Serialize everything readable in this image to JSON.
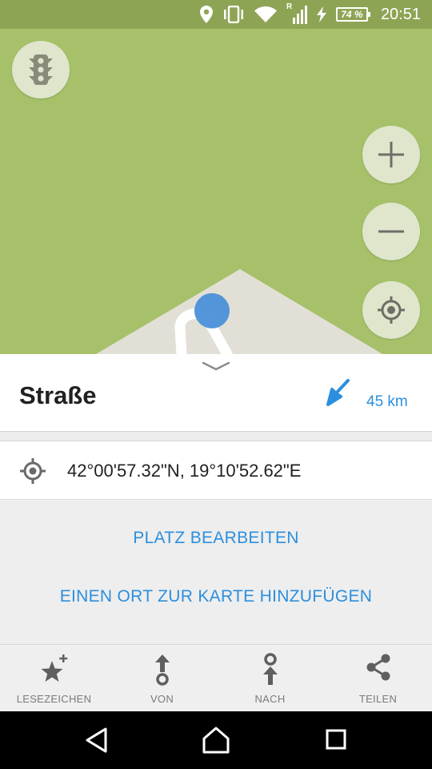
{
  "status_bar": {
    "battery_percent": "74 %",
    "clock": "20:51",
    "roaming_indicator": "R",
    "icons": [
      "location-icon",
      "vibrate-icon",
      "wifi-icon",
      "signal-icon",
      "charging-icon",
      "battery-icon"
    ]
  },
  "map": {
    "buttons": [
      "traffic-icon",
      "zoom-in-icon",
      "zoom-out-icon",
      "my-location-icon"
    ]
  },
  "place": {
    "title": "Straße",
    "distance": "45 km",
    "coordinates": "42°00'57.32\"N, 19°10'52.62\"E"
  },
  "actions": {
    "edit_place": "PLATZ BEARBEITEN",
    "add_place": "EINEN ORT ZUR KARTE HINZUFÜGEN"
  },
  "bottom_tabs": [
    {
      "label": "LESEZEICHEN",
      "icon": "bookmark-star-icon"
    },
    {
      "label": "VON",
      "icon": "route-from-icon"
    },
    {
      "label": "NACH",
      "icon": "route-to-icon"
    },
    {
      "label": "TEILEN",
      "icon": "share-icon"
    }
  ],
  "colors": {
    "map_green": "#a6c16a",
    "accent_blue": "#2c8fde",
    "status_green": "#8ea455"
  }
}
